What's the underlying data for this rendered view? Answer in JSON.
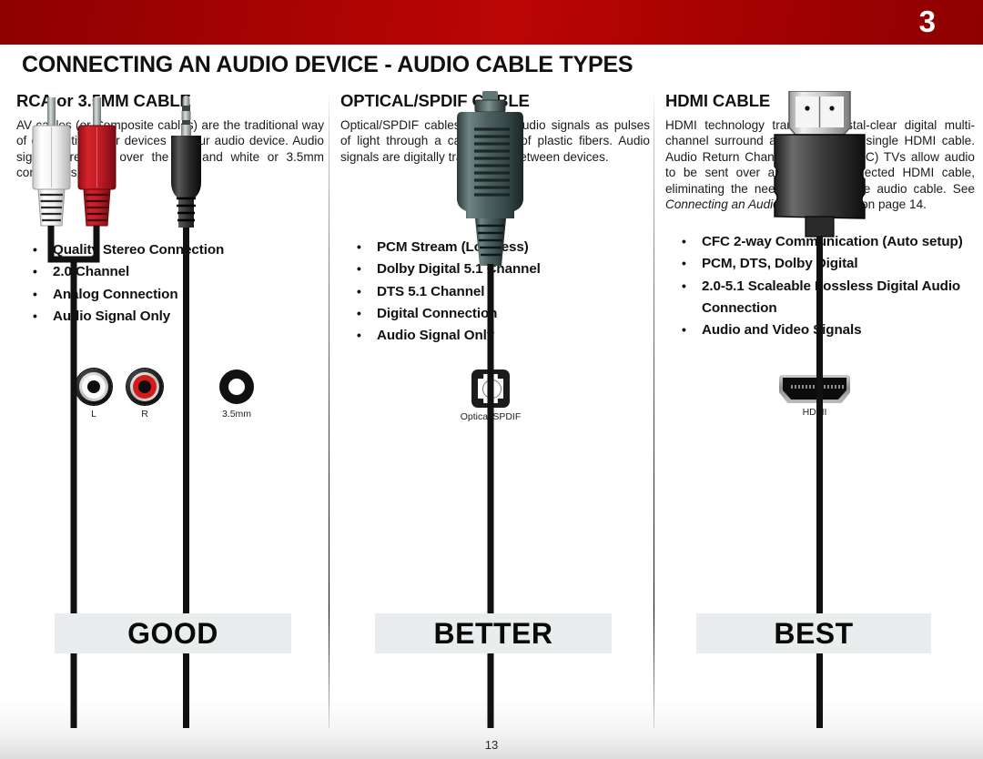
{
  "header": {
    "chapter_number": "3",
    "title": "CONNECTING AN AUDIO DEVICE - AUDIO CABLE TYPES",
    "bar_color": "#a90404"
  },
  "columns": [
    {
      "heading": "RCA or 3.5MM CABLE",
      "body": "AV cables (or Composite cables) are the traditional way of connecting your devices to your audio device. Audio signals are sent over the red and white or 3.5mm connectors.",
      "bullets": [
        "Quality Stereo Connection",
        "2.0 Channel",
        "Analog Connection",
        "Audio Signal Only"
      ],
      "port_labels": [
        "L",
        "R",
        "3.5mm"
      ],
      "rating": "GOOD"
    },
    {
      "heading": "OPTICAL/SPDIF CABLE",
      "body": "Optical/SPDIF cables transmit audio signals as pulses of light through a cable made of plastic fibers. Audio signals are digitally transmitted between devices.",
      "bullets": [
        "PCM Stream (Lossless)",
        "Dolby Digital 5.1 Channel",
        "DTS 5.1 Channel",
        "Digital Connection",
        "Audio Signal Only"
      ],
      "port_labels": [
        "Optical/SPDIF"
      ],
      "rating": "BETTER"
    },
    {
      "heading": "HDMI CABLE",
      "body_part1": "HDMI technology transmits crystal-clear digital multi-channel surround audio through a single HDMI cable. Audio Return Channel-enabled (ARC) TVs allow audio to be sent over an already connected HDMI cable, eliminating the need for a separate audio cable. See ",
      "body_italic": "Connecting an Audio Device - ARC",
      "body_part2": " on page 14.",
      "bullets": [
        "CFC 2-way Communication (Auto setup)",
        "PCM, DTS, Dolby Digital",
        "2.0-5.1 Scaleable Lossless Digital Audio Connection",
        "Audio and Video Signals"
      ],
      "port_labels": [
        "HDMI"
      ],
      "rating": "BEST"
    }
  ],
  "footer": {
    "page_number": "13"
  },
  "colors": {
    "rca_left": "#fafafa",
    "rca_right": "#d51a1a",
    "banner_bg": "#e9edee",
    "text": "#111111"
  }
}
